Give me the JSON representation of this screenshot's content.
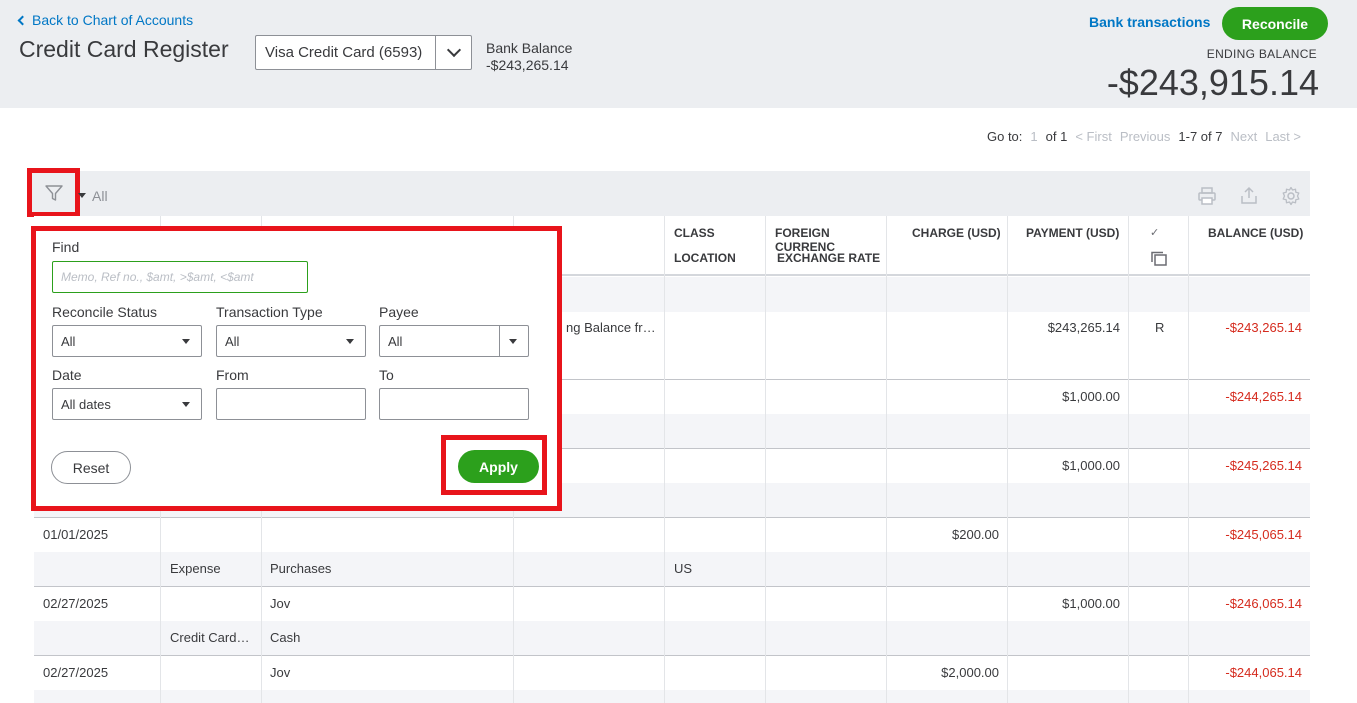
{
  "header": {
    "back_link": "Back to Chart of Accounts",
    "title": "Credit Card Register",
    "account_select": "Visa Credit Card (6593)",
    "bank_balance_label": "Bank Balance",
    "bank_balance_value": "-$243,265.14",
    "bank_transactions_link": "Bank transactions",
    "reconcile_button": "Reconcile",
    "ending_balance_label": "ENDING BALANCE",
    "ending_balance_value": "-$243,915.14"
  },
  "pager": {
    "goto_label": "Go to:",
    "page_input": "1",
    "of_pages": "of 1",
    "first": "< First",
    "previous": "Previous",
    "range": "1-7 of 7",
    "next": "Next",
    "last": "Last >"
  },
  "toolbar": {
    "filter_value": "All"
  },
  "columns": {
    "class": "CLASS",
    "location": "LOCATION",
    "foreign_currency": "FOREIGN CURRENC",
    "exchange_rate": "EXCHANGE RATE",
    "charge": "CHARGE (USD)",
    "payment": "PAYMENT (USD)",
    "check": "✓",
    "balance": "BALANCE (USD)"
  },
  "rows": [
    {
      "memo": "ng Balance fr…",
      "payment": "$243,265.14",
      "reconcile": "R",
      "balance": "-$243,265.14"
    },
    {
      "payment": "$1,000.00",
      "balance": "-$244,265.14"
    },
    {
      "payment": "$1,000.00",
      "balance": "-$245,265.14"
    },
    {
      "date": "01/01/2025",
      "charge": "$200.00",
      "balance": "-$245,065.14",
      "type": "Expense",
      "account": "Purchases",
      "location": "US"
    },
    {
      "date": "02/27/2025",
      "payee": "Jov",
      "payment": "$1,000.00",
      "balance": "-$246,065.14",
      "type": "Credit Card…",
      "account": "Cash"
    },
    {
      "date": "02/27/2025",
      "payee": "Jov",
      "charge": "$2,000.00",
      "balance": "-$244,065.14"
    }
  ],
  "filter_panel": {
    "find_label": "Find",
    "find_placeholder": "Memo, Ref no., $amt, >$amt, <$amt",
    "reconcile_status_label": "Reconcile Status",
    "reconcile_status_value": "All",
    "transaction_type_label": "Transaction Type",
    "transaction_type_value": "All",
    "payee_label": "Payee",
    "payee_value": "All",
    "date_label": "Date",
    "date_value": "All dates",
    "from_label": "From",
    "from_value": "",
    "to_label": "To",
    "to_value": "",
    "reset_button": "Reset",
    "apply_button": "Apply"
  },
  "colors": {
    "brand_green": "#2ca01c",
    "link_blue": "#0077c5",
    "highlight_red": "#e8141b",
    "negative_red": "#d52b1e"
  },
  "icons": [
    "chevron-left-icon",
    "chevron-down-icon",
    "filter-icon",
    "print-icon",
    "export-icon",
    "gear-icon",
    "copy-icon"
  ]
}
